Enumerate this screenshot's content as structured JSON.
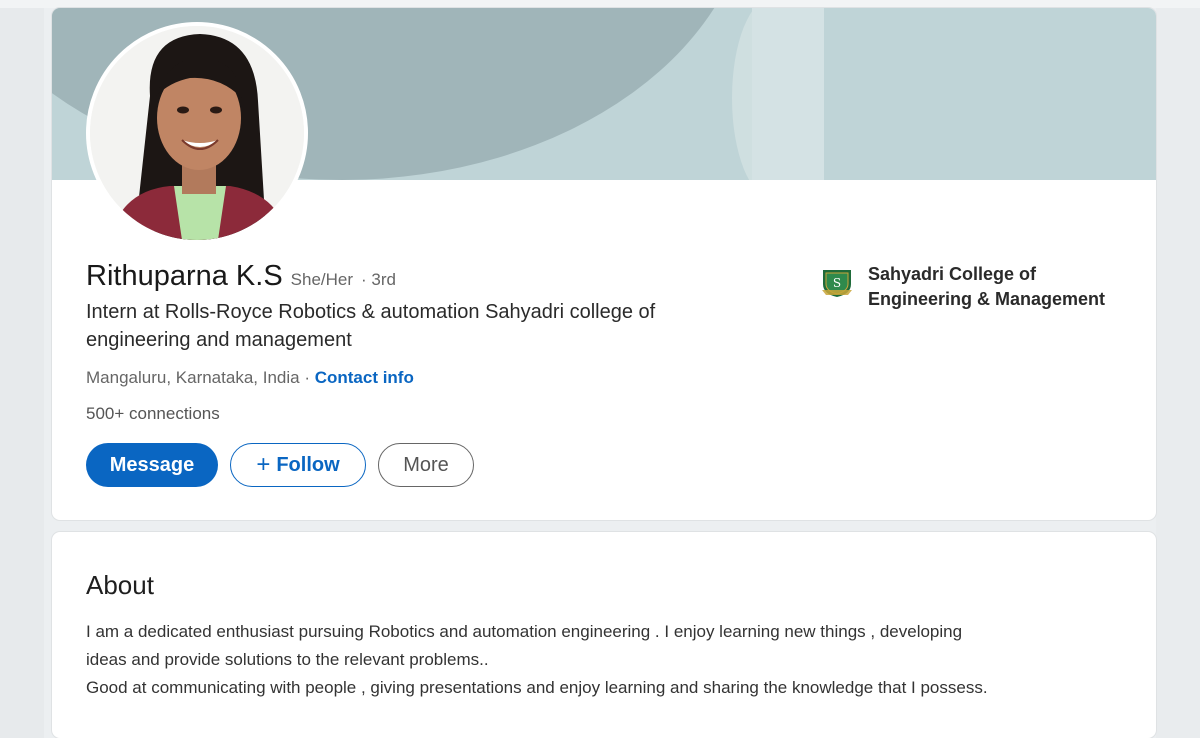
{
  "profile": {
    "name": "Rithuparna K.S",
    "pronouns": "She/Her",
    "degree": "· 3rd",
    "headline_line1": "Intern at Rolls-Royce Robotics & automation Sahyadri college of",
    "headline_line2": "engineering and management",
    "location": "Mangaluru, Karnataka, India",
    "separator": " · ",
    "contact_info": "Contact info",
    "connections": "500+ connections"
  },
  "actions": {
    "message": "Message",
    "follow": "Follow",
    "follow_icon": "+",
    "more": "More"
  },
  "education": {
    "school_line1": "Sahyadri College of",
    "school_line2": "Engineering & Management",
    "logo_letter": "S",
    "logo_icon": "school-crest-icon"
  },
  "about": {
    "title": "About",
    "line1": "I am a dedicated enthusiast pursuing Robotics and automation engineering . I enjoy learning new things , developing",
    "line2": "ideas and provide solutions to the relevant problems..",
    "line3": "Good at communicating with people , giving presentations and enjoy learning and sharing the knowledge that I possess."
  },
  "colors": {
    "accent": "#0a66c2",
    "banner": "#a0b5b9"
  }
}
